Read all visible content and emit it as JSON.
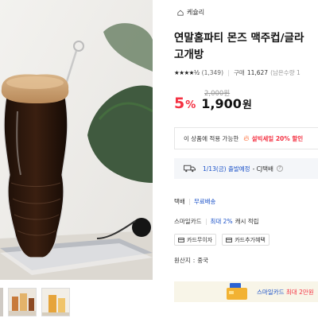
{
  "shop": {
    "name": "케슐리",
    "icon": "home-icon"
  },
  "product": {
    "title_line1": "연말홈파티 몬즈 맥주컵/글라",
    "title_line2": "고개방"
  },
  "rating": {
    "stars": "★★★★½",
    "score": 4.5,
    "review_count": "(1,349)",
    "purchase_label": "구매",
    "purchase_count": "11,627",
    "stock_text": "(남은수량 1"
  },
  "price": {
    "original": "2,000원",
    "discount": "5",
    "discount_unit": "%",
    "current": "1,900",
    "currency": "원"
  },
  "coupon": {
    "prefix": "이 상품에 적용 가능한",
    "highlight": "설빅세일 20% 할인",
    "icon": "fire-icon"
  },
  "delivery": {
    "date": "1/13(금) 출발예정",
    "carrier": "- CJ택배",
    "help": "?",
    "icon": "truck-icon"
  },
  "shipping": {
    "label": "택배",
    "value": "무료배송"
  },
  "smilecard": {
    "label": "스마일카드",
    "value": "최대 2%",
    "suffix": "캐시 적립"
  },
  "chips": [
    {
      "label": "카드무이자",
      "icon": "card-icon"
    },
    {
      "label": "카드추가혜택",
      "icon": "card-icon"
    }
  ],
  "origin": {
    "label": "원산지",
    "value": "중국"
  },
  "banner": {
    "brand": "스마일카드",
    "text": "최대 2만원"
  },
  "colors": {
    "accent": "#f43142",
    "link": "#1a51c8",
    "banner_bg": "#f8f5e8",
    "delivery_bg": "#f4f6f9"
  }
}
